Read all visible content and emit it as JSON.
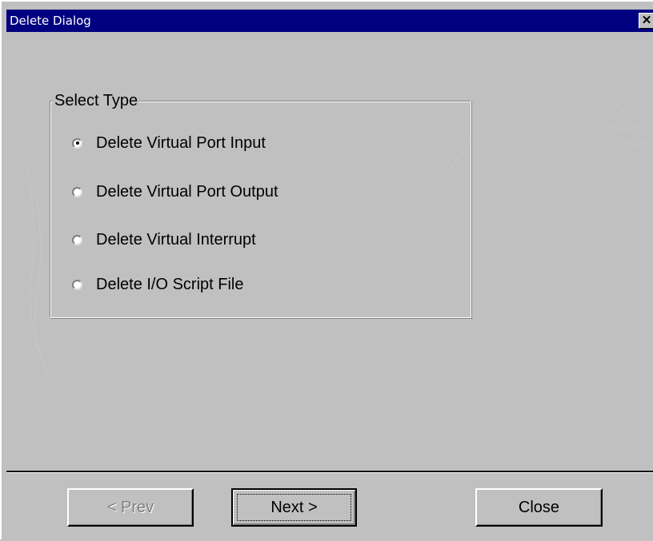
{
  "window": {
    "title": "Delete Dialog",
    "close_glyph": "✕"
  },
  "groupbox": {
    "label": "Select Type",
    "options": [
      {
        "label": "Delete Virtual Port Input",
        "checked": true
      },
      {
        "label": "Delete Virtual Port Output",
        "checked": false
      },
      {
        "label": "Delete Virtual Interrupt",
        "checked": false
      },
      {
        "label": "Delete I/O Script File",
        "checked": false
      }
    ]
  },
  "buttons": {
    "prev_label": "< Prev",
    "prev_enabled": false,
    "next_label": "Next >",
    "close_label": "Close"
  },
  "colors": {
    "titlebar": "#000080",
    "face": "#c0c0c0",
    "disabled_text": "#808080"
  }
}
